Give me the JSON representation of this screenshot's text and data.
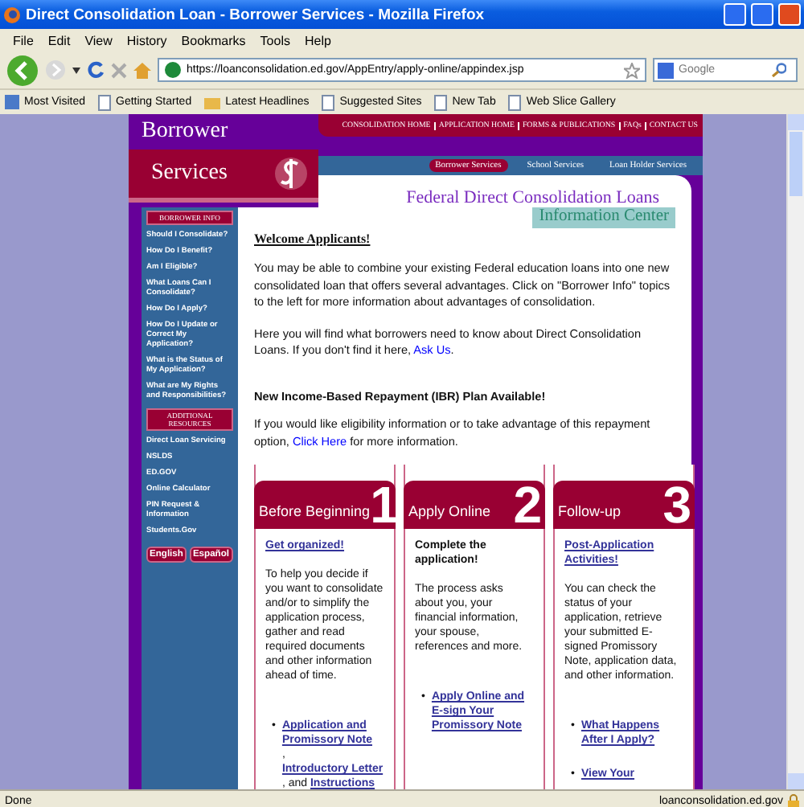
{
  "window": {
    "title": "Direct Consolidation Loan - Borrower Services - Mozilla Firefox"
  },
  "menu": [
    "File",
    "Edit",
    "View",
    "History",
    "Bookmarks",
    "Tools",
    "Help"
  ],
  "toolbar": {
    "url": "https://loanconsolidation.ed.gov/AppEntry/apply-online/appindex.jsp",
    "search_placeholder": "Google"
  },
  "bookmarks": [
    {
      "label": "Most Visited",
      "kind": "special"
    },
    {
      "label": "Getting Started",
      "kind": "page"
    },
    {
      "label": "Latest Headlines",
      "kind": "feed"
    },
    {
      "label": "Suggested Sites",
      "kind": "page"
    },
    {
      "label": "New Tab",
      "kind": "page"
    },
    {
      "label": "Web Slice Gallery",
      "kind": "page"
    }
  ],
  "page": {
    "top_nav": [
      "CONSOLIDATION HOME",
      "APPLICATION HOME",
      "FORMS & PUBLICATIONS",
      "FAQs",
      "CONTACT US"
    ],
    "logo": {
      "line1": "Borrower",
      "line2": "Services"
    },
    "service_tabs": [
      {
        "label": "Borrower Services",
        "selected": true
      },
      {
        "label": "School Services",
        "selected": false
      },
      {
        "label": "Loan Holder Services",
        "selected": false
      }
    ],
    "banner": {
      "title": "Federal Direct Consolidation Loans",
      "subtitle": "Information Center"
    },
    "sidebar": {
      "heading": "BORROWER INFO",
      "items": [
        "Should I Consolidate?",
        "How Do I Benefit?",
        "Am I Eligible?",
        "What Loans Can I Consolidate?",
        "How Do I Apply?",
        "How Do I Update or Correct My Application?",
        "What is the Status of My Application?",
        "What are My Rights and Responsibilities?"
      ],
      "resources_heading": "ADDITIONAL RESOURCES",
      "resources": [
        "Direct Loan Servicing",
        "NSLDS",
        "ED.GOV",
        "Online Calculator",
        "PIN Request & Information",
        "Students.Gov"
      ],
      "languages": [
        "English",
        "Español"
      ]
    },
    "welcome": "Welcome Applicants!",
    "paragraphs": [
      [
        {
          "text": "You may be able to combine your existing Federal education loans into one new consolidated loan that offers several advantages. Click on \"Borrower Info\" topics to the left for more information about advantages of consolidation.",
          "link": false
        }
      ],
      [
        {
          "text": "Here you will find what borrowers need to know about Direct Consolidation Loans. If you don't find it here, ",
          "link": false
        },
        {
          "text": "Ask Us",
          "link": true
        },
        {
          "text": ".",
          "link": false
        }
      ]
    ],
    "ibr_heading": "New Income-Based Repayment (IBR) Plan Available!",
    "ibr_paragraph": [
      {
        "text": "If you would like eligibility information or to take advantage of this repayment option, ",
        "link": false
      },
      {
        "text": "Click Here",
        "link": true
      },
      {
        "text": " for more information.",
        "link": false
      }
    ],
    "cards": [
      {
        "title": "Before Beginning",
        "number": "1",
        "heading": "Get organized!",
        "kind": "link",
        "body": "To help you decide if you want to consolidate and/or to simplify the application process, gather and read required documents and other information ahead of time.",
        "bullets": [
          {
            "marker": "•",
            "parts": [
              {
                "text": "Application and Promissory Note",
                "link": true
              },
              {
                "text": ", ",
                "link": false
              },
              {
                "text": "Introductory Letter",
                "link": true
              },
              {
                "text": ", and ",
                "link": false
              },
              {
                "text": "Instructions",
                "link": true
              }
            ]
          }
        ]
      },
      {
        "title": "Apply Online",
        "number": "2",
        "heading": "Complete the application!",
        "kind": "bold",
        "body": "The process asks about you, your financial information, your spouse, references and more.",
        "bullets": [
          {
            "marker": "•",
            "parts": [
              {
                "text": "Apply Online and E-sign Your Promissory Note",
                "link": true
              }
            ]
          }
        ]
      },
      {
        "title": "Follow-up",
        "number": "3",
        "heading": "Post-Application Activities!",
        "kind": "link",
        "body": "You can check the status of your application, retrieve your submitted E-signed Promissory Note, application data, and other information.",
        "bullets": [
          {
            "marker": "•",
            "parts": [
              {
                "text": "What Happens After I Apply?",
                "link": true
              }
            ]
          },
          {
            "marker": "•",
            "parts": [
              {
                "text": "View Your",
                "link": true
              }
            ]
          }
        ]
      }
    ]
  },
  "status_bar": {
    "text": "Done",
    "host": "loanconsolidation.ed.gov"
  }
}
